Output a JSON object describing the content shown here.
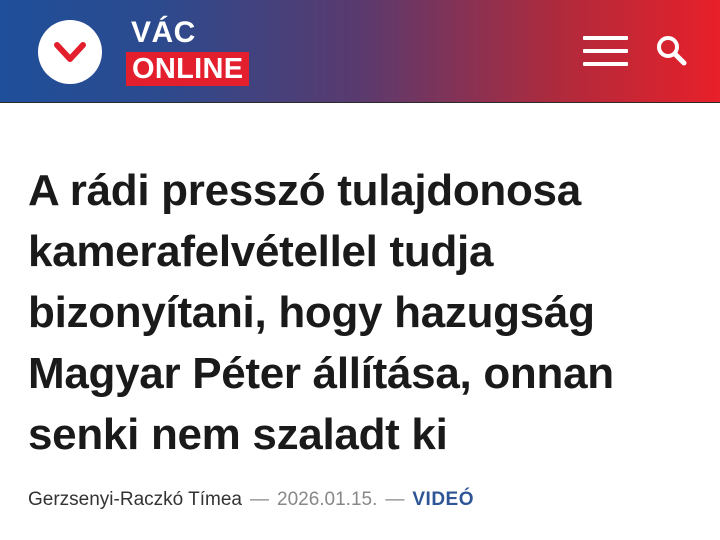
{
  "header": {
    "brand_top": "VÁC",
    "brand_bottom": "ONLINE",
    "icons": {
      "logo": "chevron-down-icon",
      "menu": "hamburger-menu-icon",
      "search": "search-icon"
    }
  },
  "article": {
    "title": "A rádi presszó tulajdonosa kamerafelvétellel tudja bizonyítani, hogy hazugság Magyar Péter állítása, onnan senki nem szaladt ki",
    "author": "Gerzsenyi-Raczkó Tímea",
    "separator": "—",
    "date": "2026.01.15.",
    "category": "VIDEÓ"
  },
  "colors": {
    "gradient_left": "#1f4f9a",
    "gradient_right": "#e8202a",
    "brand_red": "#e31e2d",
    "category_blue": "#2f5596",
    "text_dark": "#1a1a1a",
    "meta_gray": "#888888"
  }
}
